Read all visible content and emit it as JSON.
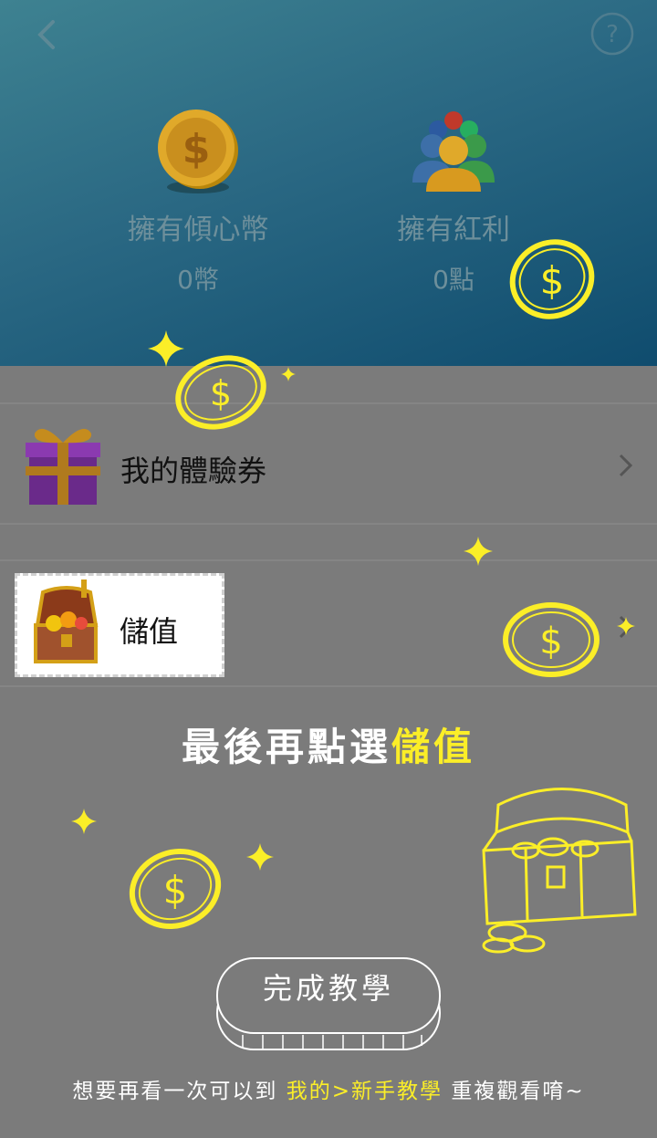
{
  "header": {
    "coins_label": "擁有傾心幣",
    "coins_value": "0幣",
    "bonus_label": "擁有紅利",
    "bonus_value": "0點"
  },
  "menu": {
    "vouchers_label": "我的體驗券",
    "topup_label": "儲值"
  },
  "tutorial": {
    "hint_prefix": "最後再點選",
    "hint_target": "儲值",
    "done_button": "完成教學",
    "footer_prefix": "想要再看一次可以到",
    "footer_path": "我的>新手教學",
    "footer_suffix": "重複觀看唷~"
  },
  "colors": {
    "accent_yellow": "#fbee28",
    "overlay_gray": "#7b7b7b"
  },
  "icons": [
    "back-icon",
    "help-icon",
    "coin-icon",
    "group-icon",
    "gift-icon",
    "treasure-chest-icon",
    "chevron-right-icon"
  ]
}
